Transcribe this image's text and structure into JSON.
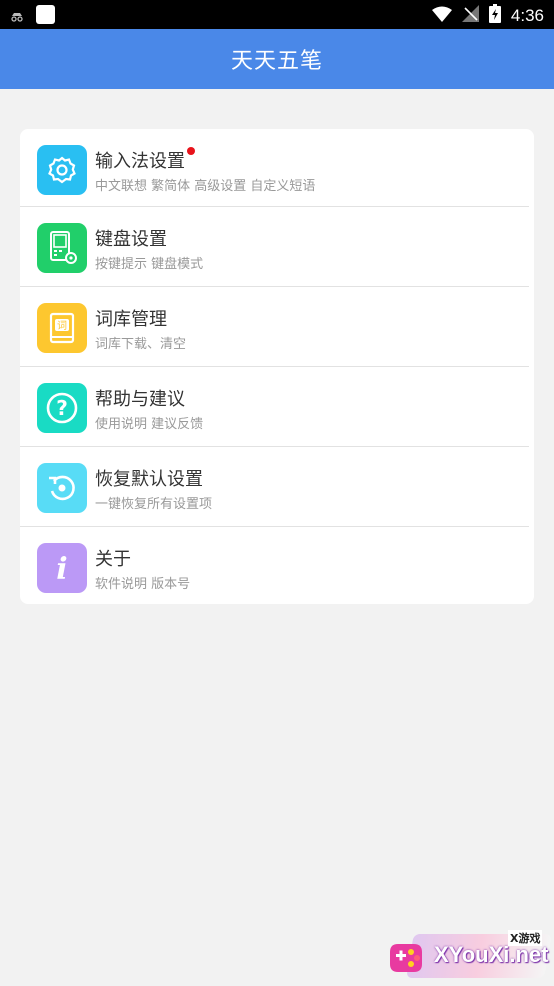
{
  "status_bar": {
    "time": "4:36",
    "icons": [
      "incognito-icon",
      "notification-square-icon",
      "wifi-icon",
      "no-signal-icon",
      "battery-charging-icon"
    ]
  },
  "app_bar": {
    "title": "天天五笔"
  },
  "menu": [
    {
      "title": "输入法设置",
      "subtitle": "中文联想 繁简体 高级设置 自定义短语",
      "icon": "gear-icon",
      "color": "#29bff2",
      "badge": true
    },
    {
      "title": "键盘设置",
      "subtitle": "按键提示 键盘模式",
      "icon": "keyboard-settings-icon",
      "color": "#21cf6a",
      "badge": false
    },
    {
      "title": "词库管理",
      "subtitle": "词库下载、清空",
      "icon": "dictionary-book-icon",
      "color": "#fdc72f",
      "badge": false
    },
    {
      "title": "帮助与建议",
      "subtitle": "使用说明 建议反馈",
      "icon": "question-icon",
      "color": "#19dbc4",
      "badge": false
    },
    {
      "title": "恢复默认设置",
      "subtitle": "一键恢复所有设置项",
      "icon": "restore-icon",
      "color": "#58dcf6",
      "badge": false
    },
    {
      "title": "关于",
      "subtitle": "软件说明 版本号",
      "icon": "info-icon",
      "color": "#bb99f6",
      "badge": false
    }
  ],
  "watermark": {
    "text": "XYouXi.net",
    "tag": "X游戏"
  }
}
